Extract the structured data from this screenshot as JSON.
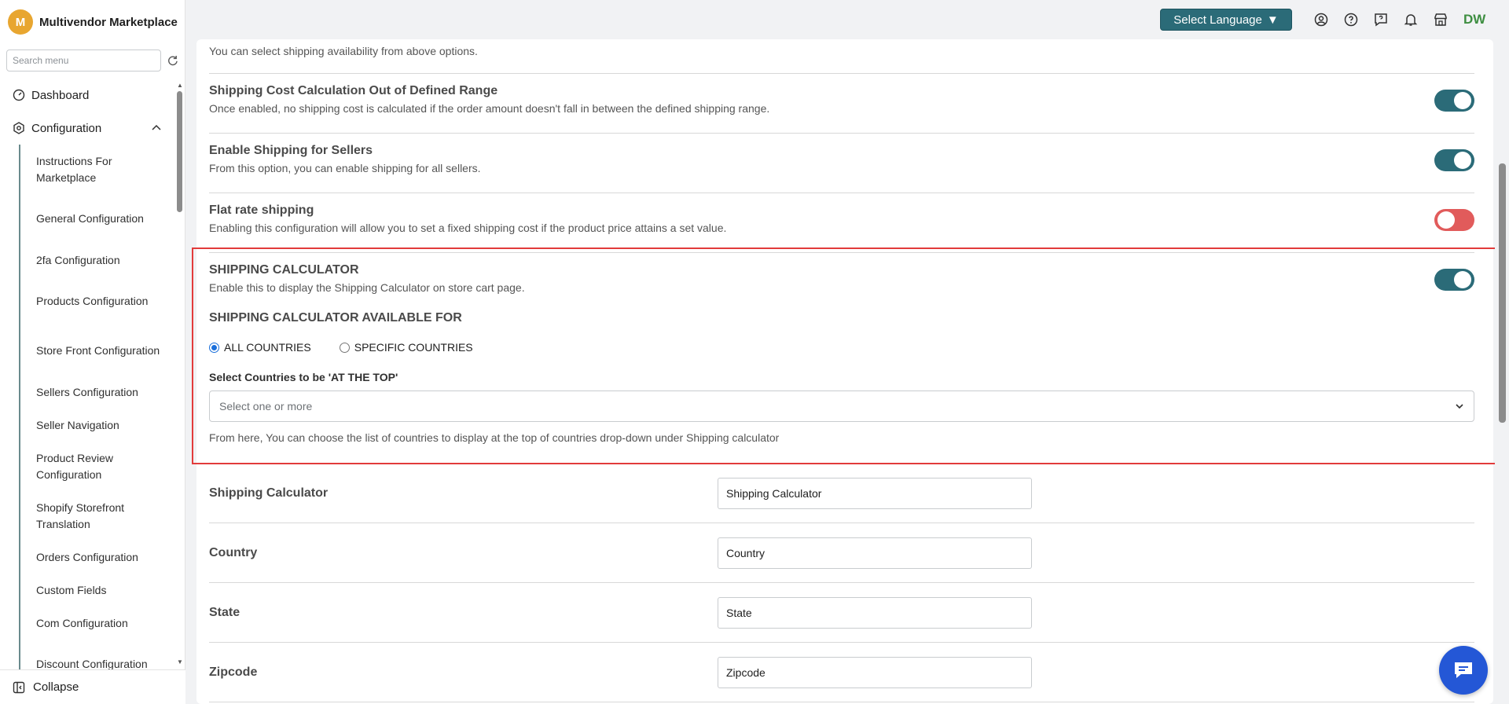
{
  "brand": {
    "initial": "M",
    "name": "Multivendor Marketplace"
  },
  "sidebar": {
    "search_placeholder": "Search menu",
    "items": [
      {
        "label": "Dashboard",
        "icon": "dashboard-icon"
      },
      {
        "label": "Configuration",
        "icon": "gear-icon"
      }
    ],
    "sub_items": [
      "Instructions For Marketplace",
      "General Configuration",
      "2fa Configuration",
      "Products Configuration",
      "Store Front Configuration",
      "Sellers Configuration",
      "Seller Navigation",
      "Product Review Configuration",
      "Shopify Storefront Translation",
      "Orders Configuration",
      "Custom Fields",
      "Com Configuration",
      "Discount Configuration"
    ],
    "collapse_label": "Collapse"
  },
  "topbar": {
    "language_button": "Select Language",
    "user_initials": "DW"
  },
  "settings": {
    "availability_note": "You can select shipping availability from above options.",
    "rows": [
      {
        "title": "Shipping Cost Calculation Out of Defined Range",
        "desc": "Once enabled, no shipping cost is calculated if the order amount doesn't fall in between the defined shipping range.",
        "enabled": true
      },
      {
        "title": "Enable Shipping for Sellers",
        "desc": "From this option, you can enable shipping for all sellers.",
        "enabled": true
      },
      {
        "title": "Flat rate shipping",
        "desc": "Enabling this configuration will allow you to set a fixed shipping cost if the product price attains a set value.",
        "enabled": false
      }
    ],
    "calculator": {
      "title": "SHIPPING CALCULATOR",
      "desc": "Enable this to display the Shipping Calculator on store cart page.",
      "enabled": true,
      "available_for_title": "SHIPPING CALCULATOR AVAILABLE FOR",
      "option_all": "ALL COUNTRIES",
      "option_specific": "SPECIFIC COUNTRIES",
      "selected_option": "ALL COUNTRIES",
      "select_label": "Select Countries to be 'AT THE TOP'",
      "select_placeholder": "Select one or more",
      "help": "From here, You can choose the list of countries to display at the top of countries drop-down under Shipping calculator"
    },
    "fields": [
      {
        "label": "Shipping Calculator",
        "value": "Shipping Calculator"
      },
      {
        "label": "Country",
        "value": "Country"
      },
      {
        "label": "State",
        "value": "State"
      },
      {
        "label": "Zipcode",
        "value": "Zipcode"
      }
    ]
  },
  "colors": {
    "accent": "#2b6b78",
    "toggle_off": "#e15b5b",
    "highlight": "#e23b3b",
    "chat": "#2457d6"
  }
}
